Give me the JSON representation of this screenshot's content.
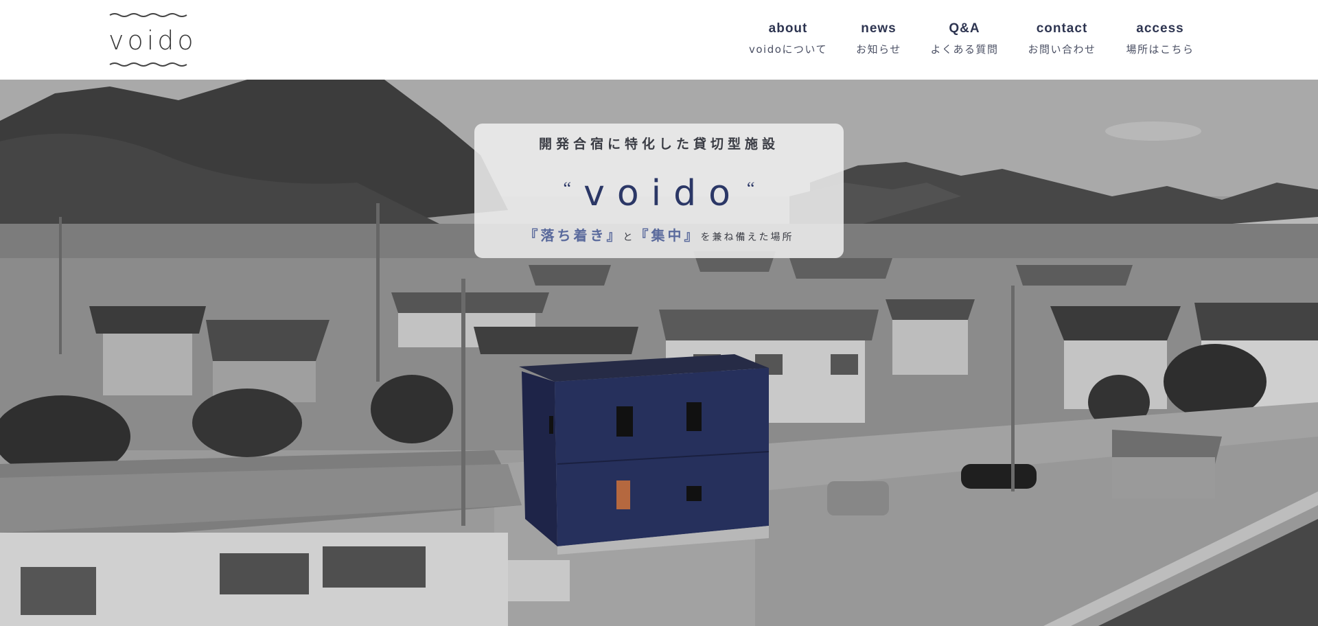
{
  "logo": {
    "text": "voido"
  },
  "nav": [
    {
      "en": "about",
      "ja": "voidoについて"
    },
    {
      "en": "news",
      "ja": "お知らせ"
    },
    {
      "en": "Q&A",
      "ja": "よくある質問"
    },
    {
      "en": "contact",
      "ja": "お問い合わせ"
    },
    {
      "en": "access",
      "ja": "場所はこちら"
    }
  ],
  "hero": {
    "tagline": "開発合宿に特化した貸切型施設",
    "quote_open": "“",
    "title": "voido",
    "quote_close": "“",
    "sub": {
      "em1": "『落ち着き』",
      "and": "と",
      "em2": "『集中』",
      "rest": "を兼ね備えた場所"
    },
    "image": "grayscale photo of a seaside town with a navy blue two-story building"
  },
  "colors": {
    "navy": "#2b3766",
    "nav_text": "#2e3551",
    "accent_sub": "#5a6a9c",
    "building": "#26305c",
    "window_glow": "#b5683f"
  }
}
